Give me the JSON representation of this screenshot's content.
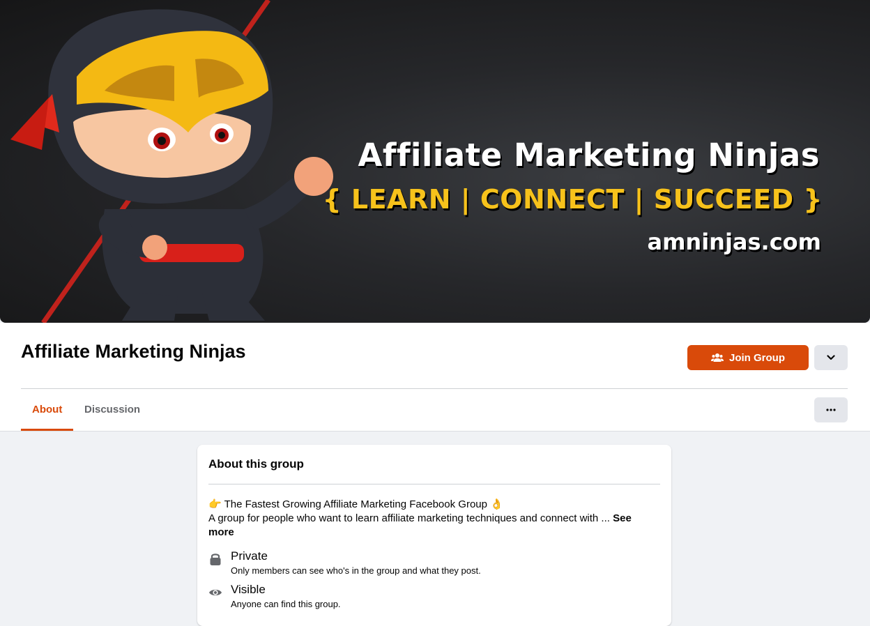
{
  "cover": {
    "title": "Affiliate Marketing Ninjas",
    "tagline": "{ LEARN | CONNECT | SUCCEED }",
    "url": "amninjas.com",
    "colors": {
      "title": "#ffffff",
      "tagline": "#f7c21b"
    }
  },
  "header": {
    "group_name": "Affiliate Marketing Ninjas",
    "join_label": "Join Group",
    "tabs": [
      {
        "label": "About"
      },
      {
        "label": "Discussion"
      }
    ]
  },
  "about": {
    "title": "About this group",
    "line1": "👉 The Fastest Growing Affiliate Marketing Facebook Group 👌",
    "line2": "A group for people who want to learn affiliate marketing techniques and connect with ...",
    "see_more": "See more",
    "privacy": {
      "title": "Private",
      "desc": "Only members can see who's in the group and what they post.",
      "icon": "lock-icon"
    },
    "visibility": {
      "title": "Visible",
      "desc": "Anyone can find this group.",
      "icon": "eye-icon"
    }
  },
  "colors": {
    "accent": "#d94a0a",
    "button_gray": "#e4e6eb",
    "background": "#f0f2f5"
  }
}
